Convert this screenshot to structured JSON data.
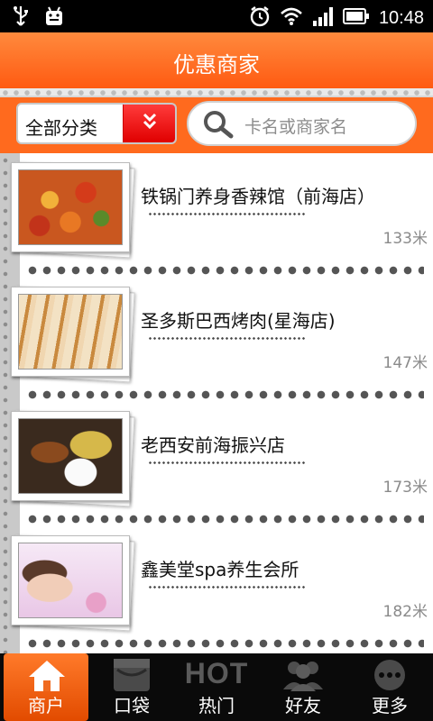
{
  "status_bar": {
    "time": "10:48",
    "icons": [
      "usb-icon",
      "android-debug-icon",
      "alarm-icon",
      "wifi-icon",
      "signal-icon",
      "battery-icon"
    ]
  },
  "header": {
    "title": "优惠商家"
  },
  "filter": {
    "category_label": "全部分类",
    "search_placeholder": "卡名或商家名"
  },
  "merchants": [
    {
      "name": "铁锅门养身香辣馆（前海店）",
      "distance": "133米",
      "image": "spicy-dish"
    },
    {
      "name": "圣多斯巴西烤肉(星海店)",
      "distance": "147米",
      "image": "bbq-skewers"
    },
    {
      "name": "老西安前海振兴店",
      "distance": "173米",
      "image": "xian-plate"
    },
    {
      "name": "鑫美堂spa养生会所",
      "distance": "182米",
      "image": "spa-woman"
    }
  ],
  "bottom_nav": [
    {
      "label": "商户",
      "icon": "home-icon",
      "active": true
    },
    {
      "label": "口袋",
      "icon": "pocket-icon",
      "active": false
    },
    {
      "label": "热门",
      "icon": "hot-icon",
      "active": false,
      "icon_text": "HOT"
    },
    {
      "label": "好友",
      "icon": "friends-icon",
      "active": false
    },
    {
      "label": "更多",
      "icon": "more-icon",
      "active": false
    }
  ],
  "colors": {
    "brand_orange": "#ff6a1e",
    "dropdown_red": "#e00000",
    "status_bar": "#000000",
    "nav_bg": "#0a0a0a"
  }
}
